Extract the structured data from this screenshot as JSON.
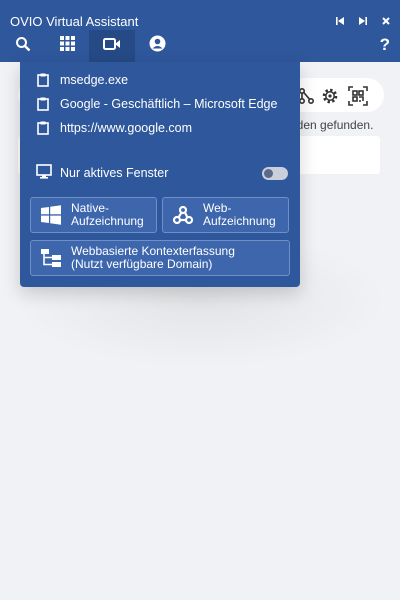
{
  "window": {
    "title": "OVIO Virtual Assistant",
    "controls": [
      "prev-icon",
      "next-icon",
      "close-icon"
    ]
  },
  "tabs": [
    {
      "name": "search",
      "icon": "search-icon",
      "active": false
    },
    {
      "name": "apps",
      "icon": "grid-icon",
      "active": false
    },
    {
      "name": "record",
      "icon": "video-camera-icon",
      "active": true
    },
    {
      "name": "account",
      "icon": "user-circle-icon",
      "active": false
    }
  ],
  "help_label": "?",
  "background": {
    "tools": [
      "share-icon",
      "gear-icon",
      "qr-code-icon"
    ],
    "status_text": "nden gefunden."
  },
  "panel": {
    "windows": [
      {
        "label": "msedge.exe",
        "icon": "clipboard-icon"
      },
      {
        "label": "Google - Geschäftlich – Microsoft Edge",
        "icon": "clipboard-icon"
      },
      {
        "label": "https://www.google.com",
        "icon": "clipboard-icon"
      }
    ],
    "active_window": {
      "label": "Nur aktives Fenster",
      "icon": "monitor-icon",
      "enabled": false
    },
    "actions": {
      "native": {
        "line1": "Native-",
        "line2": "Aufzeichnung",
        "icon": "windows-icon"
      },
      "web": {
        "line1": "Web-",
        "line2": "Aufzeichnung",
        "icon": "webhook-icon"
      },
      "context": {
        "line1": "Webbasierte Kontexterfassung",
        "line2": "(Nutzt verfügbare Domain)",
        "icon": "sitemap-icon"
      }
    }
  },
  "colors": {
    "primary": "#2f579c",
    "active_tab": "#264a86",
    "button": "#3d66ad",
    "background": "#f1f2f5"
  }
}
